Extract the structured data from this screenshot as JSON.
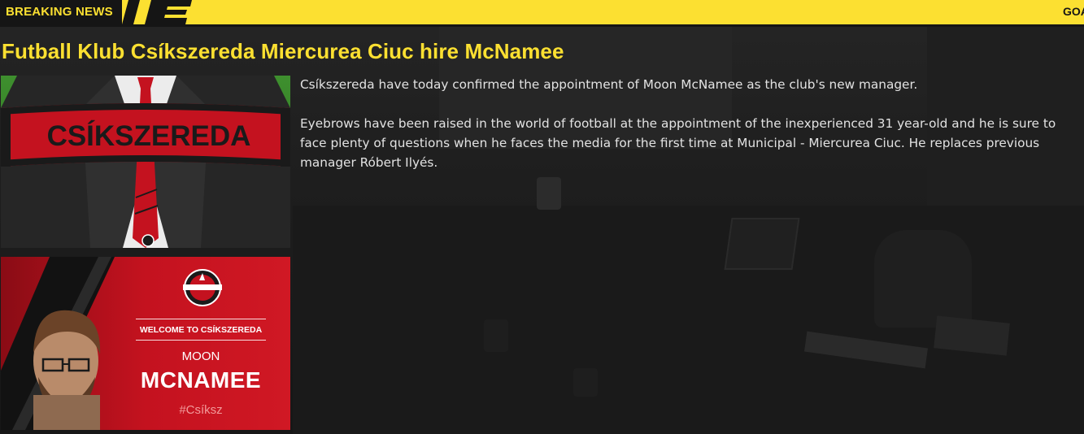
{
  "ticker": {
    "label": "BREAKING NEWS",
    "scrolling_text": "GOA"
  },
  "article": {
    "headline": "Futball Klub Csíkszereda Miercurea Ciuc hire McNamee",
    "paragraphs": [
      "Csíkszereda have today confirmed the appointment of Moon McNamee as the club's new manager.",
      "Eyebrows have been raised in the world of football at the appointment of the inexperienced 31 year-old and he is sure to face plenty of questions when he faces the media for the first time at Municipal - Miercurea Ciuc. He replaces previous manager Róbert Ilyés."
    ]
  },
  "scarf_image": {
    "scarf_text": "CSÍKSZEREDA"
  },
  "welcome_card": {
    "welcome_text": "WELCOME TO CSÍKSZEREDA",
    "first_name": "MOON",
    "last_name": "MCNAMEE",
    "hashtag": "#Csíksz"
  },
  "colors": {
    "accent_yellow": "#fce031",
    "club_red": "#c4121f",
    "text_light": "#e2e2e2",
    "background": "#1b1b1b"
  }
}
